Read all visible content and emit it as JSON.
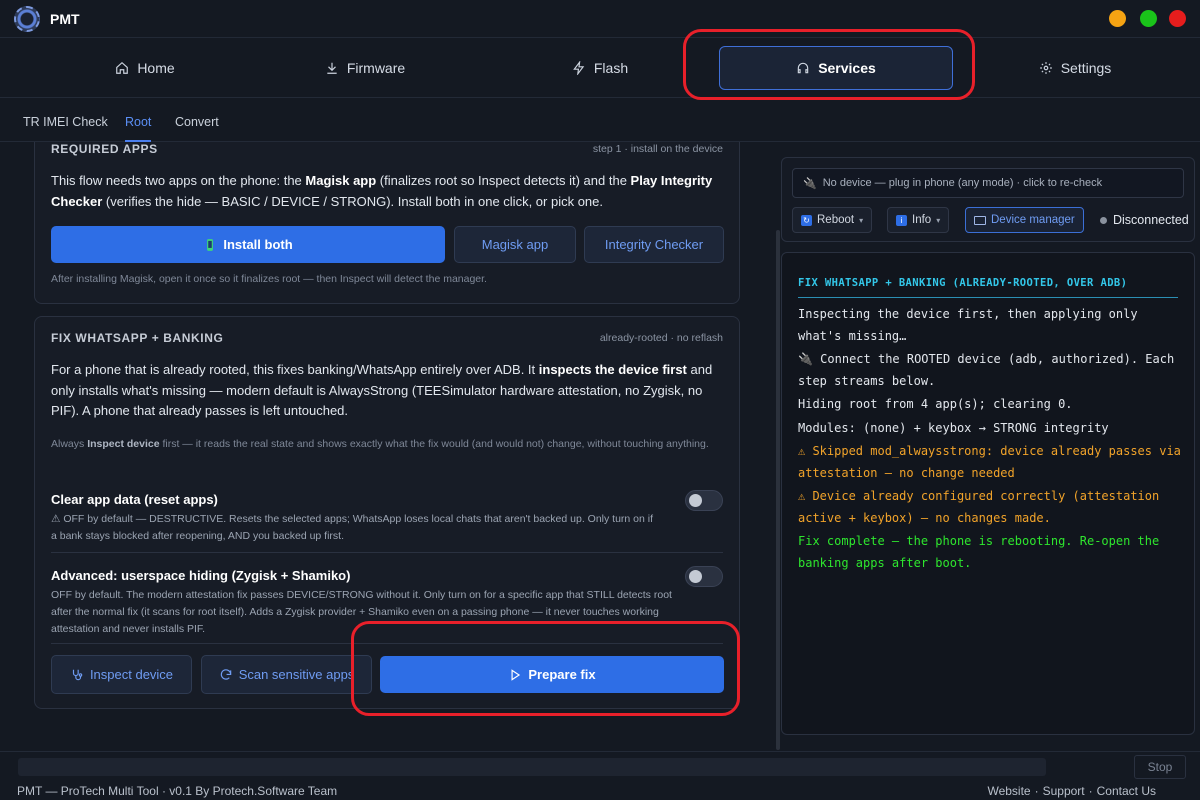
{
  "app": {
    "title": "PMT"
  },
  "nav": {
    "items": [
      {
        "label": "Home",
        "icon": "home-icon"
      },
      {
        "label": "Firmware",
        "icon": "download-icon"
      },
      {
        "label": "Flash",
        "icon": "bolt-icon"
      },
      {
        "label": "Services",
        "icon": "headset-icon",
        "active": true
      },
      {
        "label": "Settings",
        "icon": "gear-icon"
      }
    ]
  },
  "subtabs": [
    {
      "label": "TR IMEI Check"
    },
    {
      "label": "Root",
      "active": true
    },
    {
      "label": "Convert"
    }
  ],
  "required": {
    "title": "REQUIRED APPS",
    "meta": "step 1 · install on the device",
    "text_pre": "This flow needs two apps on the phone: the ",
    "text_b1": "Magisk app",
    "text_mid": " (finalizes root so Inspect detects it) and the ",
    "text_b2": "Play Integrity Checker",
    "text_post": " (verifies the hide — BASIC / DEVICE / STRONG). Install both in one click, or pick one.",
    "install_both": "Install both",
    "magisk_app": "Magisk app",
    "integrity_checker": "Integrity Checker",
    "hint": "After installing Magisk, open it once so it finalizes root — then Inspect will detect the manager."
  },
  "fix": {
    "title": "FIX WHATSAPP + BANKING",
    "meta": "already-rooted · no reflash",
    "text_pre": "For a phone that is already rooted, this fixes banking/WhatsApp entirely over ADB. It ",
    "text_b": "inspects the device first",
    "text_post": " and only installs what's missing — modern default is AlwaysStrong (TEESimulator hardware attestation, no Zygisk, no PIF). A phone that already passes is left untouched.",
    "hint_pre": "Always ",
    "hint_b": "Inspect device",
    "hint_post": " first — it reads the real state and shows exactly what the fix would (and would not) change, without touching anything.",
    "opt1_title": "Clear app data (reset apps)",
    "opt1_desc": "⚠ OFF by default — DESTRUCTIVE. Resets the selected apps; WhatsApp loses local chats that aren't backed up. Only turn on if a bank stays blocked after reopening, AND you backed up first.",
    "opt2_title": "Advanced: userspace hiding (Zygisk + Shamiko)",
    "opt2_desc": "OFF by default. The modern attestation fix passes DEVICE/STRONG without it. Only turn on for a specific app that STILL detects root after the normal fix (it scans for root itself). Adds a Zygisk provider + Shamiko even on a passing phone — it never touches working attestation and never installs PIF.",
    "inspect_device": "Inspect device",
    "scan_apps": "Scan sensitive apps",
    "prepare_fix": "Prepare fix"
  },
  "device": {
    "placeholder": "No device — plug in phone (any mode) · click to re-check",
    "reboot": "Reboot",
    "info": "Info",
    "device_manager": "Device manager",
    "status": "Disconnected"
  },
  "console": {
    "title": "FIX WHATSAPP + BANKING (ALREADY-ROOTED, OVER ADB)",
    "lines": [
      {
        "text": "Inspecting the device first, then applying only what's missing…",
        "kind": "normal"
      },
      {
        "text": "🔌 Connect the ROOTED device (adb, authorized). Each step streams below.",
        "kind": "normal"
      },
      {
        "text": "Hiding root from 4 app(s); clearing 0.",
        "kind": "normal"
      },
      {
        "text": "Modules: (none) + keybox → STRONG integrity",
        "kind": "normal"
      },
      {
        "text": "⚠ Skipped mod_alwaysstrong: device already passes via attestation — no change needed",
        "kind": "warn"
      },
      {
        "text": "⚠ Device already configured correctly (attestation active + keybox) — no changes made.",
        "kind": "warn"
      },
      {
        "text": "Fix complete — the phone is rebooting. Re-open the banking apps after boot.",
        "kind": "ok"
      }
    ]
  },
  "footer": {
    "stop": "Stop",
    "credit": "PMT — ProTech Multi Tool · v0.1 By Protech.Software Team",
    "website": "Website",
    "support": "Support",
    "contact": "Contact Us",
    "sep": "·"
  }
}
